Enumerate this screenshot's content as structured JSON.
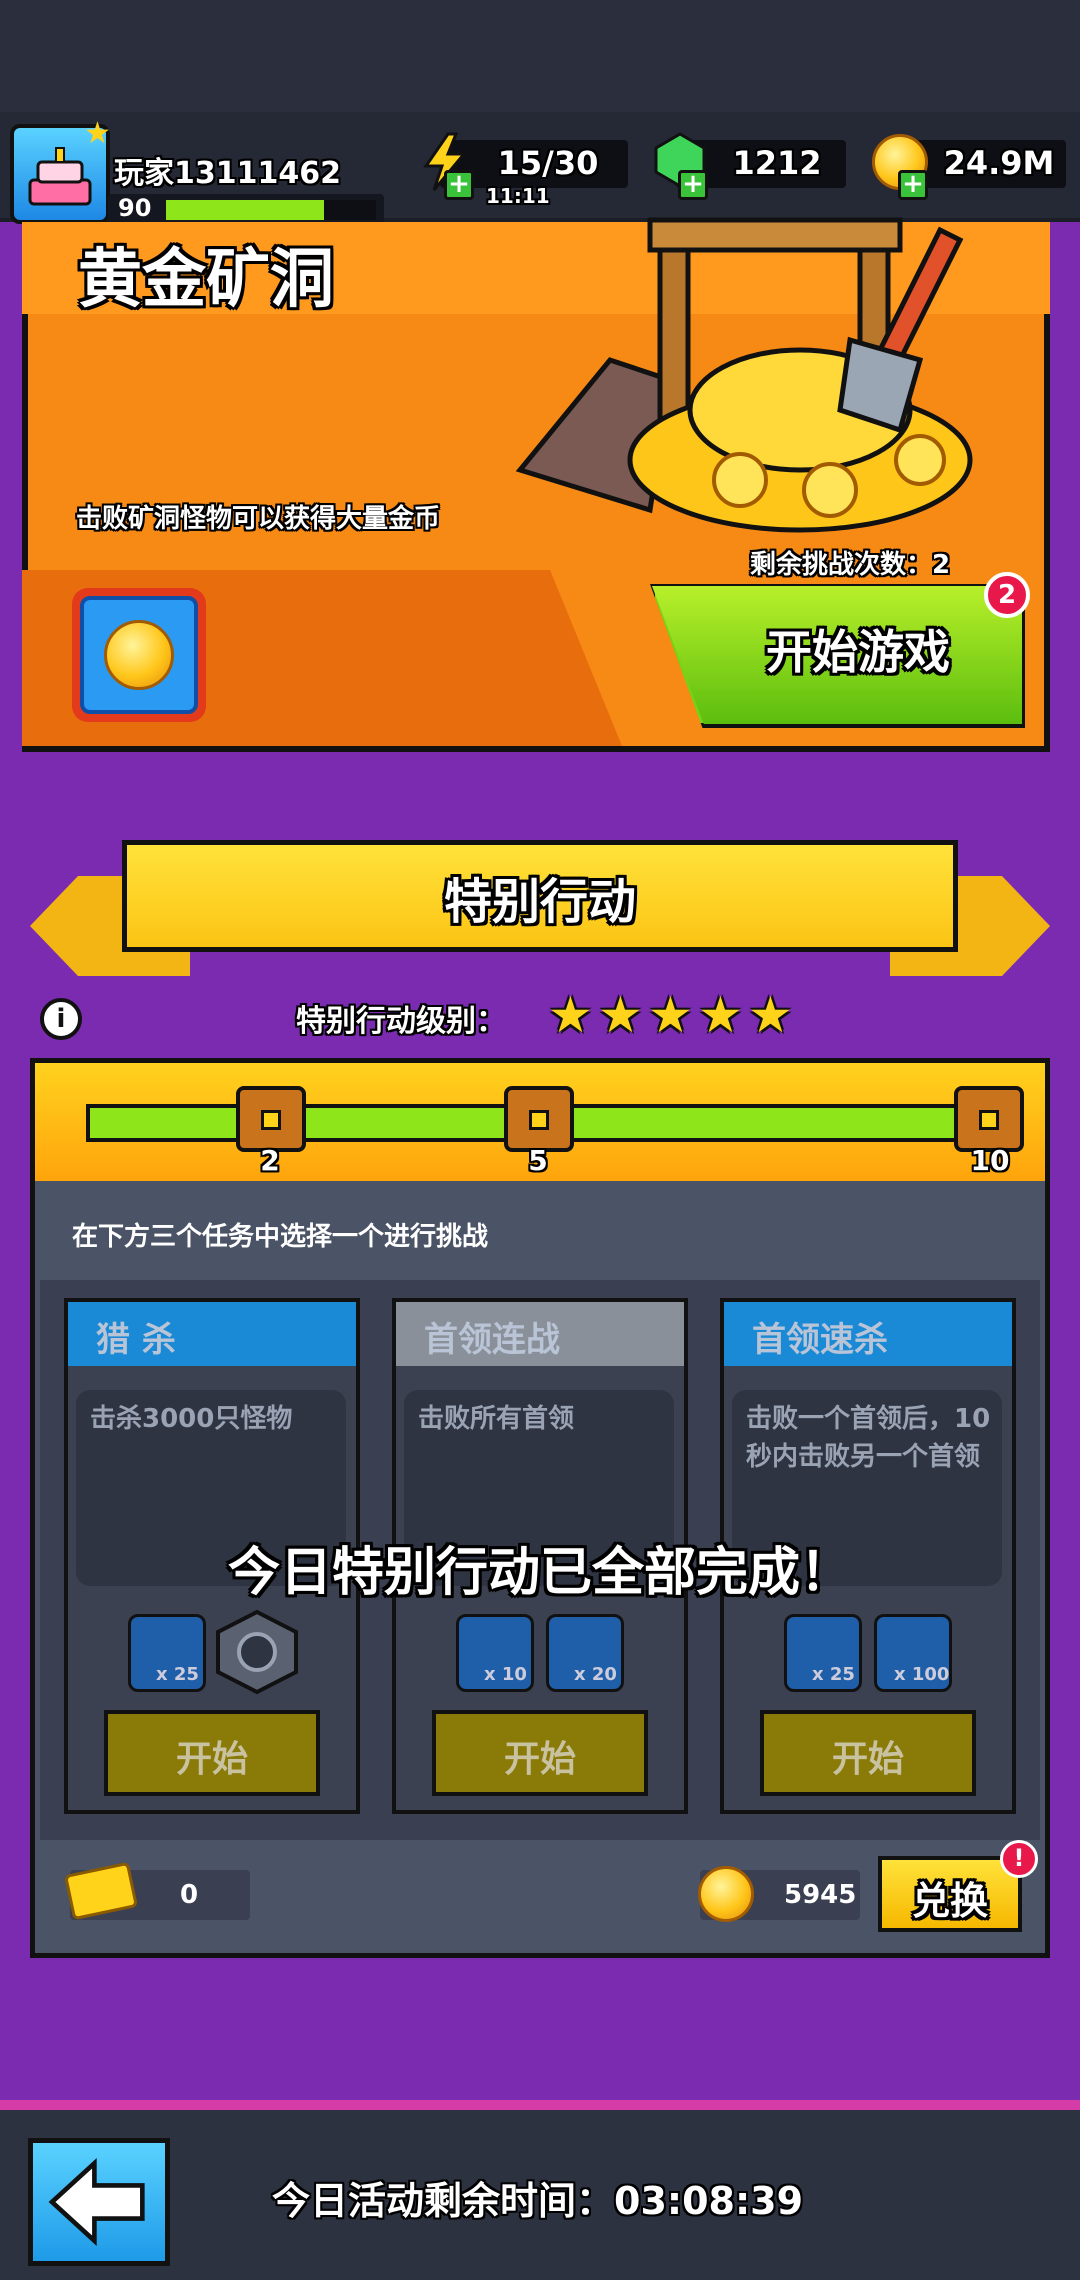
{
  "player": {
    "name": "玩家13111462",
    "level": "90",
    "xp_fraction": 0.75
  },
  "resources": {
    "energy": "15/30",
    "energy_timer": "11:11",
    "gems": "1212",
    "coins": "24.9M"
  },
  "mine": {
    "title": "黄金矿洞",
    "description": "击败矿洞怪物可以获得大量金币",
    "remaining": "剩余挑战次数：2",
    "start_label": "开始游戏",
    "badge": "2"
  },
  "special": {
    "title": "特别行动",
    "level_label": "特别行动级别：",
    "stars": 5,
    "milestones": [
      "2",
      "5",
      "10"
    ],
    "instruction": "在下方三个任务中选择一个进行挑战",
    "completed_msg": "今日特别行动已全部完成！",
    "tasks": [
      {
        "title": "猎 杀",
        "desc": "击杀3000只怪物",
        "rewards": [
          "x 25",
          ""
        ],
        "button": "开始"
      },
      {
        "title": "首领连战",
        "desc": "击败所有首领",
        "rewards": [
          "x 10",
          "x 20"
        ],
        "button": "开始"
      },
      {
        "title": "首领速杀",
        "desc": "击败一个首领后，10秒内击败另一个首领",
        "rewards": [
          "x 25",
          "x 100"
        ],
        "button": "开始"
      }
    ],
    "tickets": "0",
    "shop_coins": "5945",
    "exchange_label": "兑换",
    "alert": "!"
  },
  "footer": {
    "timer": "今日活动剩余时间：03:08:39"
  },
  "colors": {
    "accent_green": "#8ee61a",
    "gold": "#ffd31a",
    "panel_purple": "#7a2bb0"
  }
}
